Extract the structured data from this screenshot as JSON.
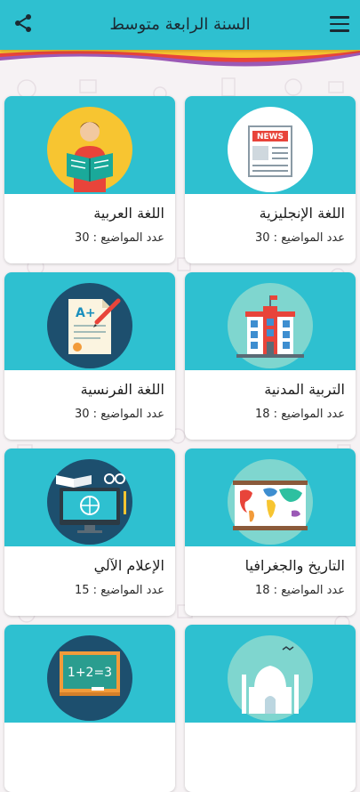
{
  "appbar": {
    "title": "السنة الرابعة متوسط",
    "menu_icon": "hamburger-menu-icon",
    "share_icon": "share-icon"
  },
  "colors": {
    "primary": "#2ec0d0",
    "stripe_yellow": "#f7c531",
    "stripe_red": "#e8443a",
    "stripe_purple": "#9b59b6"
  },
  "subjects": [
    {
      "name": "اللغة الإنجليزية",
      "count": "عدد المواضيع : 30",
      "icon": "newspaper-icon"
    },
    {
      "name": "اللغة العربية",
      "count": "عدد المواضيع : 30",
      "icon": "reading-person-icon"
    },
    {
      "name": "التربية المدنية",
      "count": "عدد المواضيع : 18",
      "icon": "building-icon"
    },
    {
      "name": "اللغة الفرنسية",
      "count": "عدد المواضيع : 30",
      "icon": "graded-paper-icon"
    },
    {
      "name": "التاريخ والجغرافيا",
      "count": "عدد المواضيع : 18",
      "icon": "world-map-icon"
    },
    {
      "name": "الإعلام الآلي",
      "count": "عدد المواضيع : 15",
      "icon": "computer-icon"
    },
    {
      "name": "",
      "count": "",
      "icon": "monument-icon"
    },
    {
      "name": "",
      "count": "",
      "icon": "chalkboard-icon"
    }
  ]
}
